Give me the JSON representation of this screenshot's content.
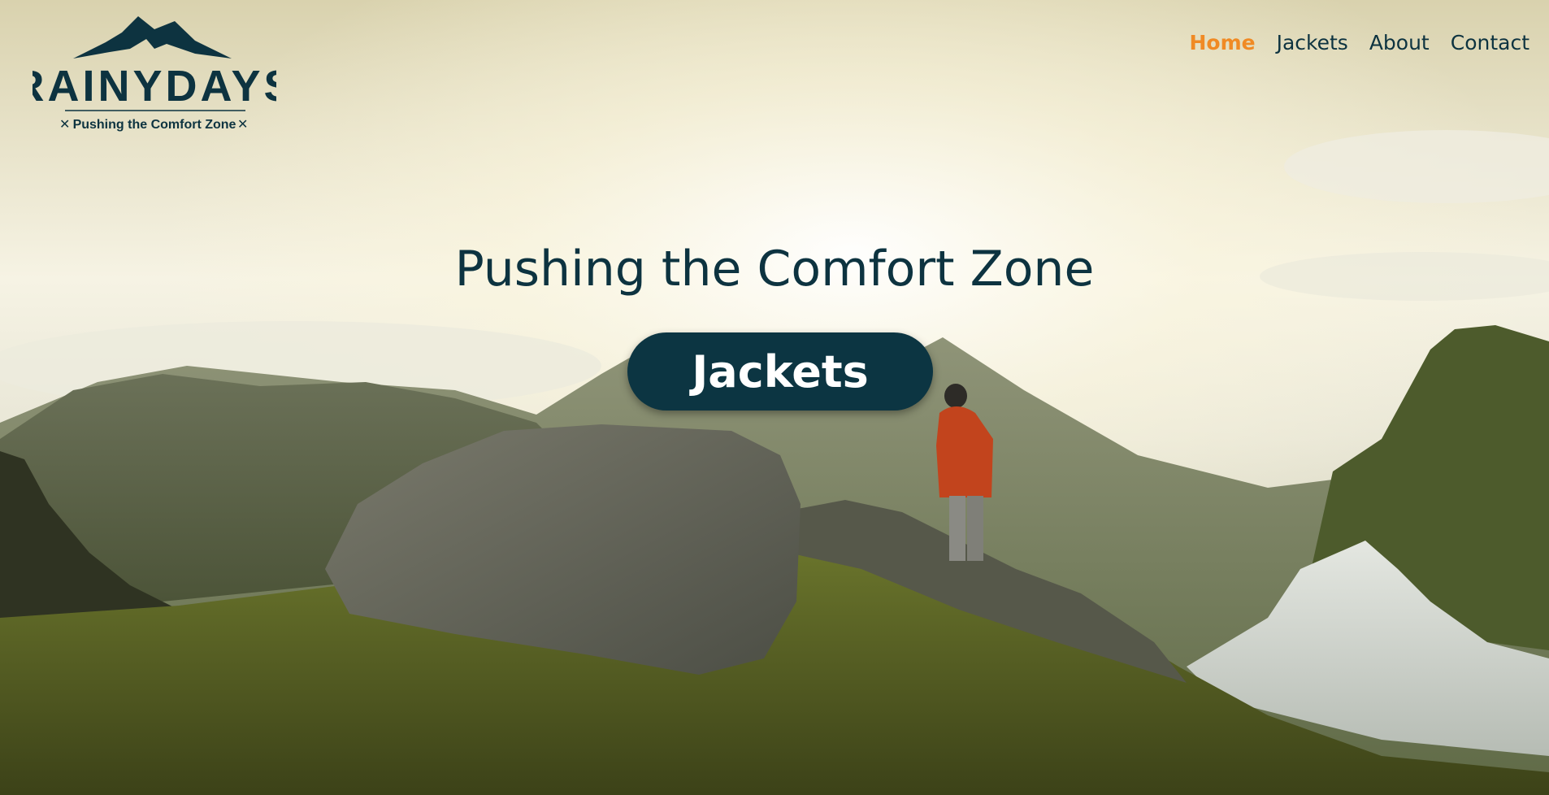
{
  "logo": {
    "brand_name": "RAINYDAYS",
    "tagline": "Pushing the Comfort Zone",
    "icon": "mountain-logo-icon",
    "color": "#0d3340"
  },
  "nav": {
    "items": [
      {
        "label": "Home",
        "active": true
      },
      {
        "label": "Jackets",
        "active": false
      },
      {
        "label": "About",
        "active": false
      },
      {
        "label": "Contact",
        "active": false
      }
    ],
    "active_color": "#f08a24"
  },
  "hero": {
    "headline": "Pushing the Comfort Zone",
    "cta_label": "Jackets",
    "background": "mountain-landscape-photo",
    "text_color": "#0d3340",
    "button_color": "#0c3542"
  }
}
